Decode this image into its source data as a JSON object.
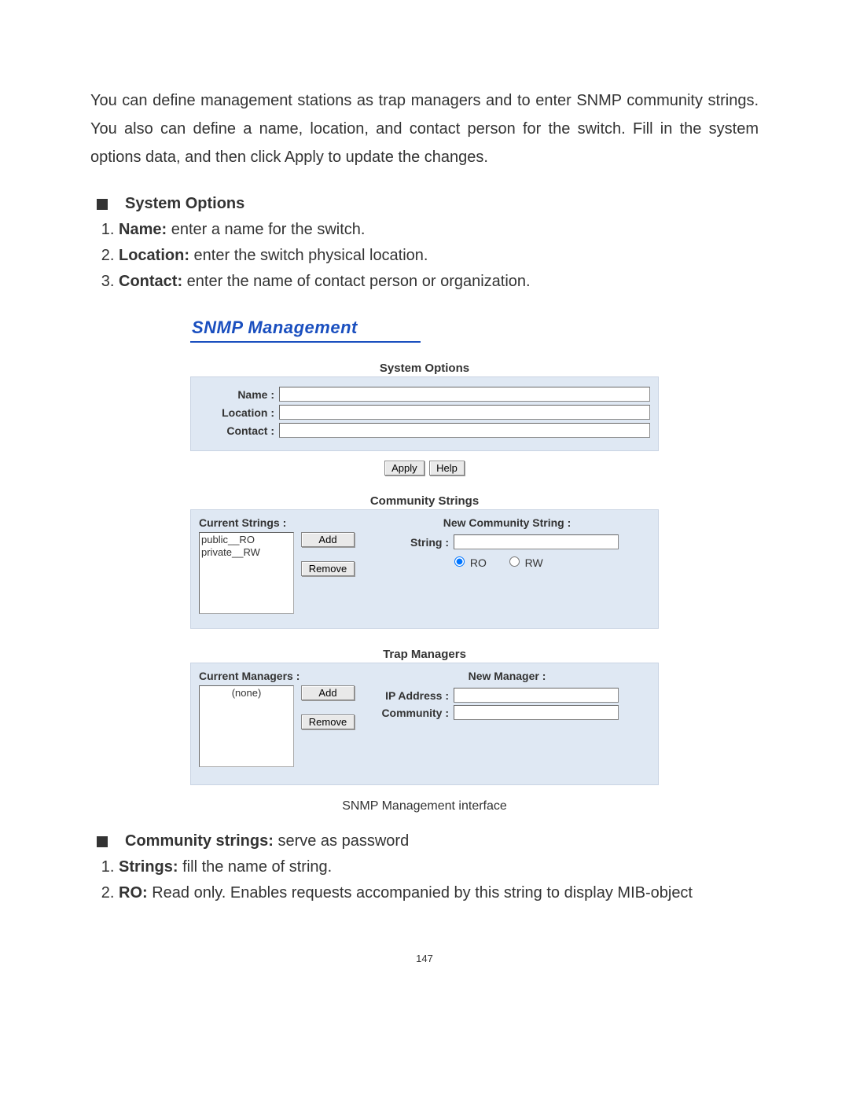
{
  "intro": "You can define management stations as trap managers and to enter SNMP community strings. You also can define a name, location, and contact person for the switch. Fill in the system options data, and then click Apply to update the changes.",
  "sysopt_head": "System Options",
  "sysopt_items": [
    {
      "b": "Name:",
      "t": " enter a name for the switch."
    },
    {
      "b": "Location:",
      "t": " enter the switch physical location."
    },
    {
      "b": "Contact:",
      "t": " enter the name of contact person or organization."
    }
  ],
  "ui": {
    "title": "SNMP Management",
    "sys_title": "System Options",
    "labels": {
      "name": "Name :",
      "location": "Location :",
      "contact": "Contact :"
    },
    "values": {
      "name": "",
      "location": "",
      "contact": ""
    },
    "apply": "Apply",
    "help": "Help",
    "comm_title": "Community Strings",
    "comm_left_head": "Current Strings :",
    "comm_right_head": "New Community String :",
    "comm_list": [
      "public__RO",
      "private__RW"
    ],
    "add": "Add",
    "remove": "Remove",
    "string_lbl": "String :",
    "string_val": "",
    "ro": "RO",
    "rw": "RW",
    "access_selected": "RO",
    "trap_title": "Trap Managers",
    "trap_left_head": "Current Managers :",
    "trap_right_head": "New Manager :",
    "trap_list_placeholder": "(none)",
    "ip_lbl": "IP Address :",
    "ip_val": "",
    "community_lbl": "Community :",
    "community_val": ""
  },
  "caption": "SNMP Management interface",
  "comm_head": "Community strings:",
  "comm_head_rest": " serve as password",
  "comm_items": [
    {
      "b": "Strings:",
      "t": " fill the name of string."
    },
    {
      "b": "RO:",
      "t": " Read only. Enables requests accompanied by this string to display MIB-object"
    }
  ],
  "page_number": "147"
}
